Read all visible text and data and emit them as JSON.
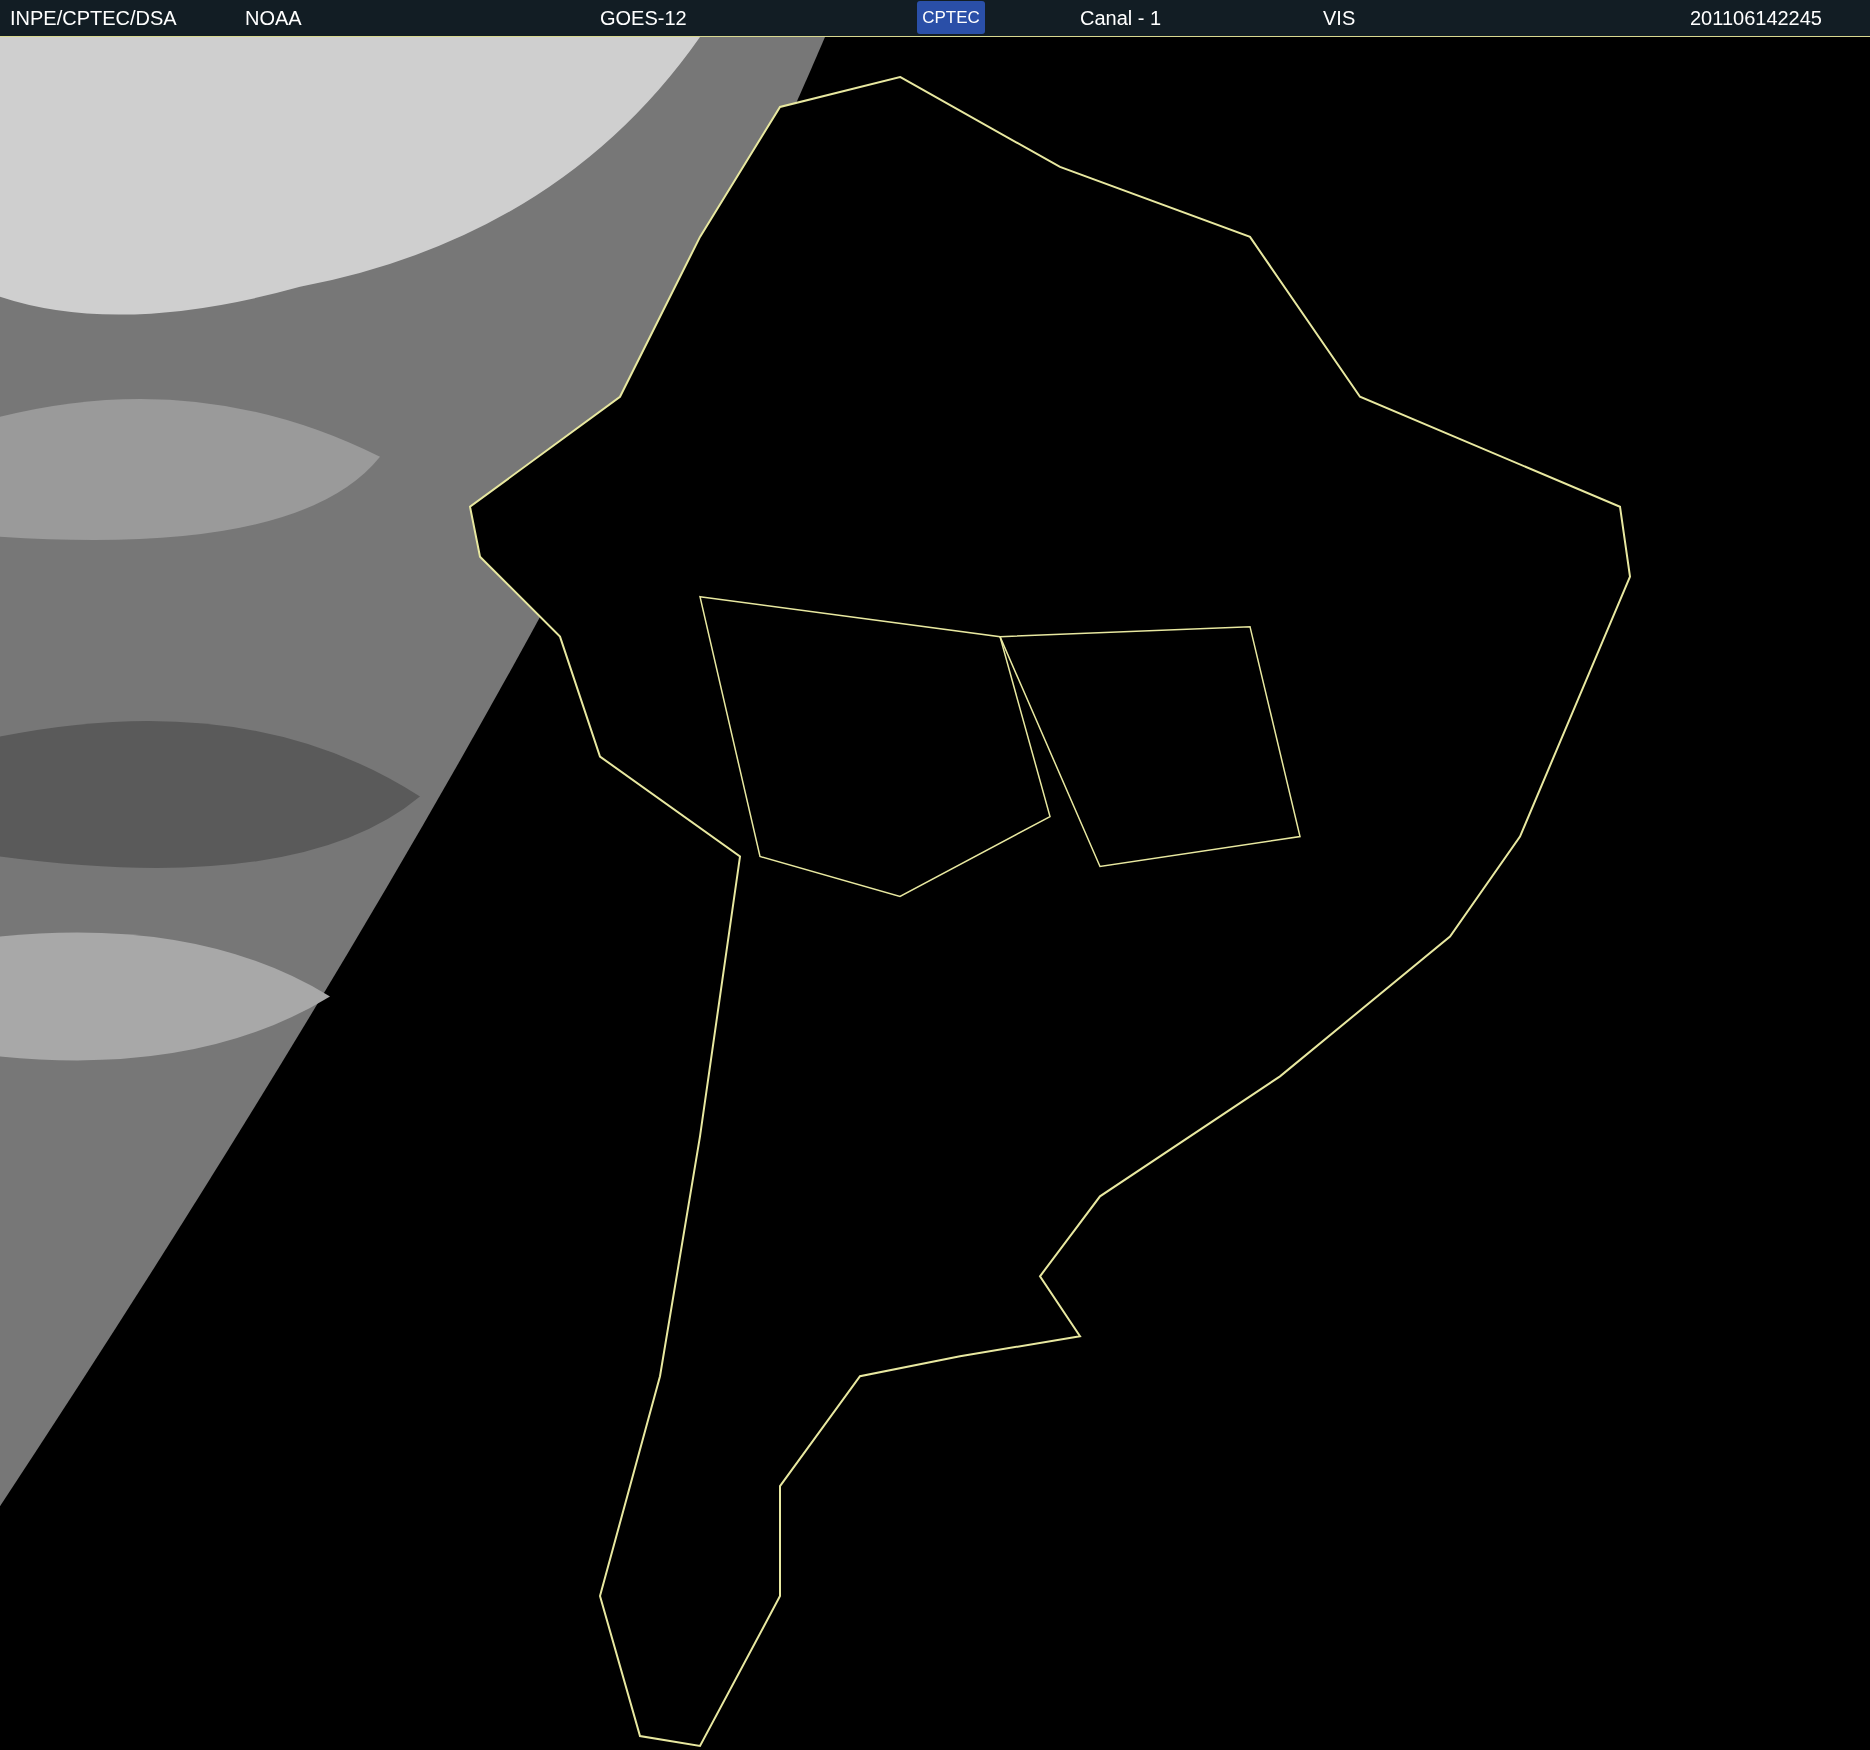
{
  "header": {
    "source": "INPE/CPTEC/DSA",
    "agency": "NOAA",
    "satellite": "GOES-12",
    "logo": "CPTEC",
    "channel": "Canal - 1",
    "band": "VIS",
    "timestamp": "201106142245"
  }
}
